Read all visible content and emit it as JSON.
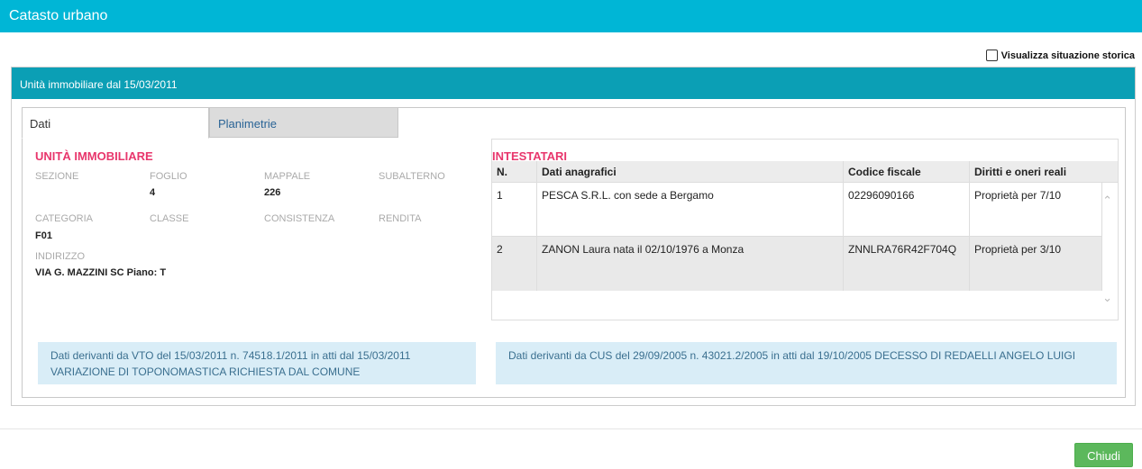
{
  "window": {
    "title": "Catasto urbano"
  },
  "historic_toggle": {
    "label": "Visualizza situazione storica",
    "checked": false
  },
  "panel": {
    "title": "Unità immobiliare dal 15/03/2011"
  },
  "tabs": [
    {
      "label": "Dati",
      "active": true
    },
    {
      "label": "Planimetrie",
      "active": false
    }
  ],
  "unit": {
    "title": "UNITÀ IMMOBILIARE",
    "sezione_label": "SEZIONE",
    "foglio_label": "FOGLIO",
    "foglio_value": "4",
    "mappale_label": "MAPPALE",
    "mappale_value": "226",
    "subalterno_label": "SUBALTERNO",
    "categoria_label": "CATEGORIA",
    "categoria_value": "F01",
    "classe_label": "CLASSE",
    "consistenza_label": "CONSISTENZA",
    "rendita_label": "RENDITA",
    "indirizzo_label": "INDIRIZZO",
    "indirizzo_value": "VIA G. MAZZINI SC Piano: T"
  },
  "owners": {
    "title": "INTESTATARI",
    "columns": [
      "N.",
      "Dati anagrafici",
      "Codice fiscale",
      "Diritti e oneri reali"
    ],
    "rows": [
      {
        "n": "1",
        "anagrafica": "PESCA S.R.L. con sede a Bergamo",
        "cf": "02296090166",
        "diritti": "Proprietà per 7/10"
      },
      {
        "n": "2",
        "anagrafica": "ZANON Laura nata il 02/10/1976 a Monza",
        "cf": "ZNNLRA76R42F704Q",
        "diritti": "Proprietà per 3/10"
      }
    ]
  },
  "notes": {
    "left": "Dati derivanti da VTO del 15/03/2011 n. 74518.1/2011 in atti dal 15/03/2011 VARIAZIONE DI TOPONOMASTICA RICHIESTA DAL COMUNE",
    "right": "Dati derivanti da CUS del 29/09/2005 n. 43021.2/2005 in atti dal 19/10/2005 DECESSO DI REDAELLI ANGELO LUIGI"
  },
  "footer": {
    "close_label": "Chiudi"
  },
  "colors": {
    "titlebar": "#00b6d6",
    "panel_header": "#0b9fb5",
    "section_title": "#e8366c",
    "info_bg": "#d9edf7",
    "close_button": "#5cb85c"
  },
  "icons": {
    "scroll_up": "chevron-up-icon",
    "scroll_down": "chevron-down-icon"
  }
}
